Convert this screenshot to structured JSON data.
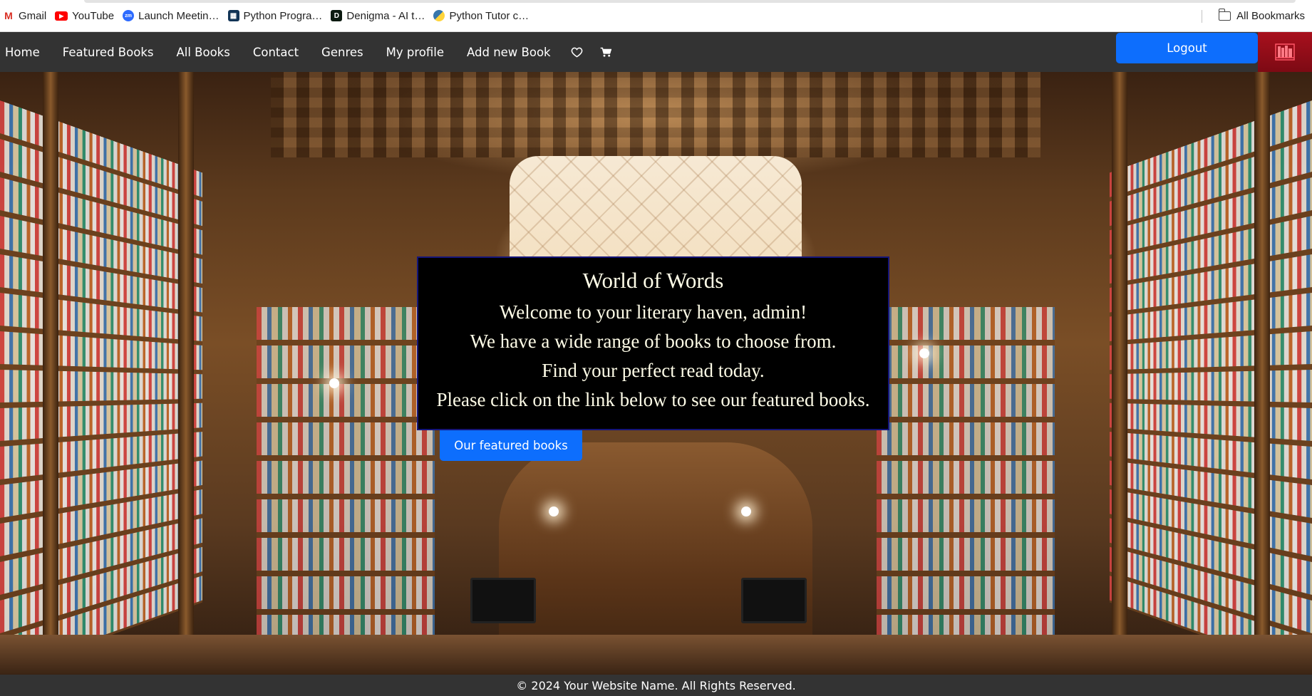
{
  "bookmarks": {
    "items": [
      {
        "label": "Gmail",
        "icon": "gmail-icon"
      },
      {
        "label": "YouTube",
        "icon": "youtube-icon"
      },
      {
        "label": "Launch Meetin…",
        "icon": "zoom-icon"
      },
      {
        "label": "Python Progra…",
        "icon": "python-programiz-icon"
      },
      {
        "label": "Denigma - AI t…",
        "icon": "denigma-icon"
      },
      {
        "label": "Python Tutor c…",
        "icon": "python-icon"
      }
    ],
    "all_bookmarks": "All Bookmarks"
  },
  "navbar": {
    "items": [
      "Home",
      "Featured Books",
      "All Books",
      "Contact",
      "Genres",
      "My profile",
      "Add new Book"
    ],
    "wishlist_icon": "heart-icon",
    "cart_icon": "cart-icon",
    "logout": "Logout",
    "logo_icon": "bookstore-logo-icon"
  },
  "hero": {
    "title": "World of Words",
    "lines": [
      "Welcome to your literary haven, admin!",
      "We have a wide range of books to choose from.",
      "Find your perfect read today.",
      "Please click on the link below to see our featured books."
    ],
    "button": "Our featured books"
  },
  "footer": {
    "text": "© 2024 Your Website Name. All Rights Reserved."
  },
  "colors": {
    "navbar_bg": "#333333",
    "primary_button": "#0d6efd",
    "logo_bg": "#a8101d",
    "card_bg": "#000000",
    "card_text": "#fffde8"
  }
}
